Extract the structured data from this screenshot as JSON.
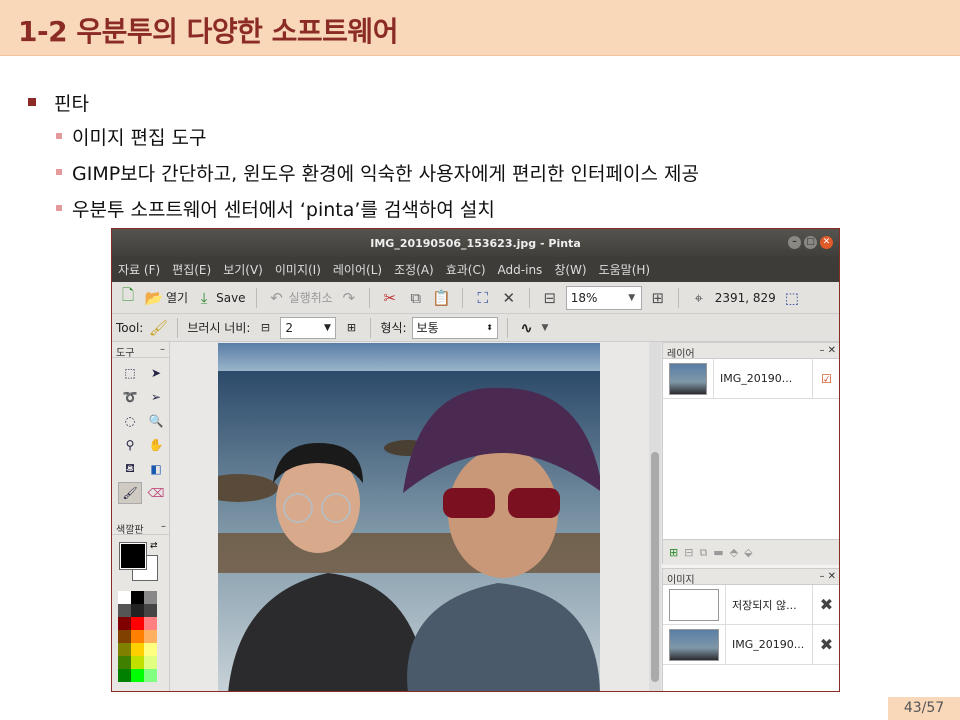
{
  "slide": {
    "title": "1-2 우분투의 다양한 소프트웨어",
    "page_number": "43/57"
  },
  "bullets": {
    "main": "핀타",
    "subs": [
      "이미지 편집 도구",
      "GIMP보다 간단하고, 윈도우 환경에 익숙한 사용자에게 편리한 인터페이스 제공",
      "우분투 소프트웨어 센터에서 ‘pinta’를 검색하여 설치"
    ]
  },
  "pinta": {
    "window_title": "IMG_20190506_153623.jpg - Pinta",
    "menu": [
      "자료 (F)",
      "편집(E)",
      "보기(V)",
      "이미지(I)",
      "레이어(L)",
      "조정(A)",
      "효과(C)",
      "Add-ins",
      "창(W)",
      "도움말(H)"
    ],
    "toolbar": {
      "open_label": "열기",
      "save_label": "Save",
      "undo_label": "실행취소",
      "zoom_value": "18%",
      "coords": "2391, 829"
    },
    "toolbar2": {
      "tool_label": "Tool:",
      "brush_width_label": "브러시 너비:",
      "brush_width_value": "2",
      "style_label": "형식:",
      "style_value": "보통"
    },
    "tools_panel_title": "도구",
    "palette_panel_title": "색깔판",
    "layers_panel": {
      "title": "레이어",
      "items": [
        {
          "name": "IMG_20190..."
        }
      ]
    },
    "images_panel": {
      "title": "이미지",
      "items": [
        {
          "name": "저장되지 않..."
        },
        {
          "name": "IMG_20190..."
        }
      ]
    },
    "colors": {
      "primary": "#000000",
      "secondary": "#ffffff"
    }
  }
}
